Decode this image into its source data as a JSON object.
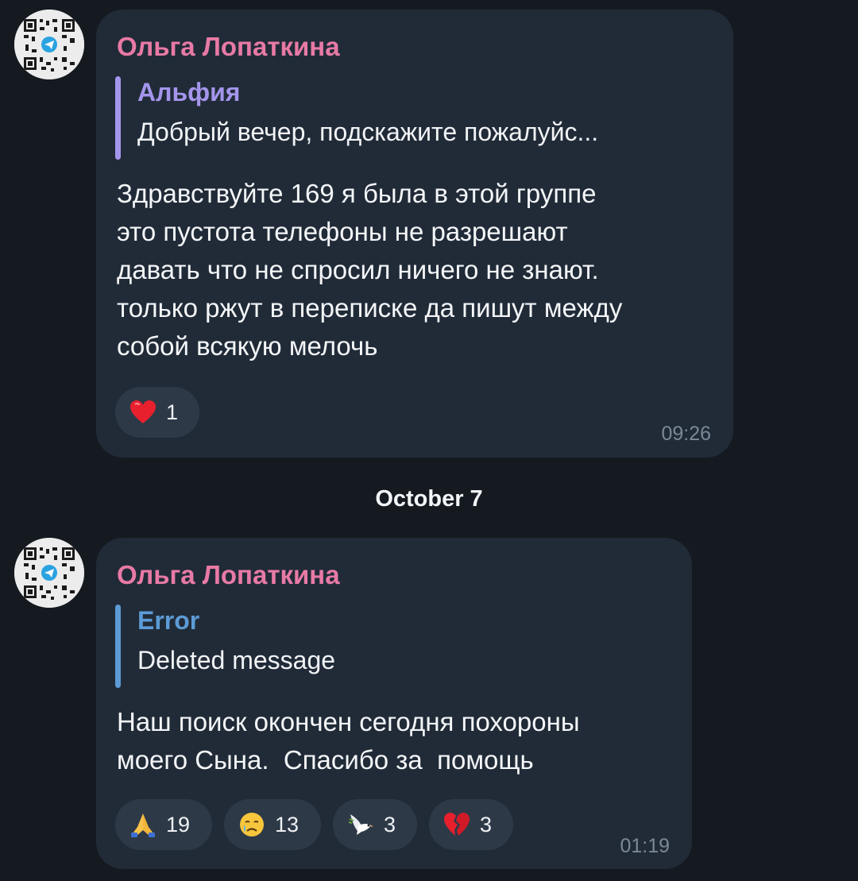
{
  "colors": {
    "background": "#151a21",
    "bubble": "#212b38",
    "sender": "#e87aa5",
    "reply_purple": "#a495ec",
    "reply_blue": "#5c9bd6",
    "reaction_bg": "#2e3947",
    "time": "#7d8896"
  },
  "messages": [
    {
      "sender": "Ольга Лопаткина",
      "avatar_icon": "qr-code-telegram-avatar",
      "reply": {
        "name": "Альфия",
        "text": "Добрый вечер, подскажите пожалуйс..."
      },
      "text_lines": [
        "Здравствуйте 169 я была в этой группе",
        "это пустота телефоны не разрешают",
        "давать что не спросил ничего не знают.",
        "только ржут в переписке да пишут между",
        "собой всякую мелочь"
      ],
      "reactions": [
        {
          "icon": "red-heart-icon",
          "count": "1"
        }
      ],
      "time": "09:26"
    },
    {
      "sender": "Ольга Лопаткина",
      "avatar_icon": "qr-code-telegram-avatar",
      "reply": {
        "name": "Error",
        "text": "Deleted message"
      },
      "text_lines": [
        "Наш поиск окончен сегодня похороны",
        "моего Сына.  Спасибо за  помощь"
      ],
      "reactions": [
        {
          "icon": "folded-hands-icon",
          "count": "19"
        },
        {
          "icon": "crying-face-icon",
          "count": "13"
        },
        {
          "icon": "dove-icon",
          "count": "3"
        },
        {
          "icon": "broken-heart-icon",
          "count": "3"
        }
      ],
      "time": "01:19"
    }
  ],
  "date_separator": "October 7"
}
